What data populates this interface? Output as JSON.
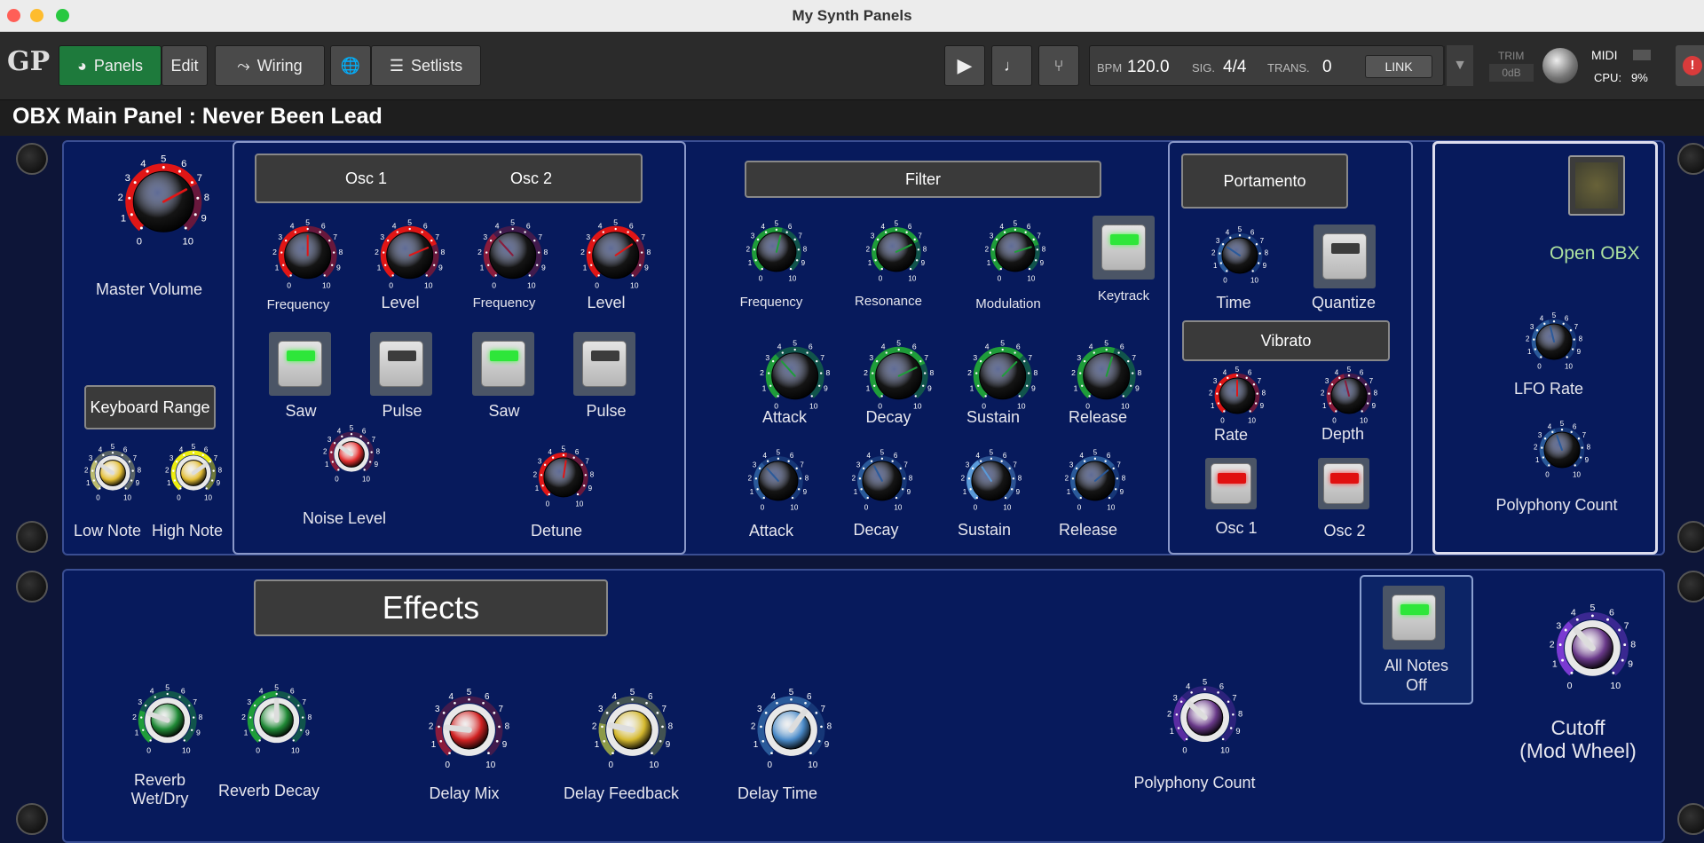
{
  "window": {
    "title": "My Synth Panels"
  },
  "toolbar": {
    "logo": "GP",
    "panels": "Panels",
    "edit": "Edit",
    "wiring": "Wiring",
    "setlists": "Setlists",
    "bpm_label": "BPM",
    "bpm": "120.0",
    "sig_label": "SIG.",
    "sig": "4/4",
    "trans_label": "TRANS.",
    "trans": "0",
    "link": "LINK",
    "trim_label": "TRIM",
    "trim": "0dB",
    "midi": "MIDI",
    "cpu_label": "CPU:",
    "cpu": "9%"
  },
  "panel_title": "OBX Main Panel : Never Been Lead",
  "buttons": {
    "osc12": {
      "osc1": "Osc 1",
      "osc2": "Osc 2"
    },
    "filter": "Filter",
    "portamento": "Portamento",
    "vibrato": "Vibrato",
    "keyboard_range": "Keyboard Range",
    "effects": "Effects"
  },
  "labels": {
    "master_volume": "Master Volume",
    "low_note": "Low Note",
    "high_note": "High Note",
    "osc1_frequency": "Frequency",
    "osc1_level": "Level",
    "osc2_frequency": "Frequency",
    "osc2_level": "Level",
    "saw1": "Saw",
    "pulse1": "Pulse",
    "saw2": "Saw",
    "pulse2": "Pulse",
    "noise_level": "Noise Level",
    "detune": "Detune",
    "filter_frequency": "Frequency",
    "resonance": "Resonance",
    "modulation": "Modulation",
    "keytrack": "Keytrack",
    "attack1": "Attack",
    "decay1": "Decay",
    "sustain1": "Sustain",
    "release1": "Release",
    "attack2": "Attack",
    "decay2": "Decay",
    "sustain2": "Sustain",
    "release2": "Release",
    "time": "Time",
    "quantize": "Quantize",
    "rate": "Rate",
    "depth": "Depth",
    "vib_osc1": "Osc 1",
    "vib_osc2": "Osc 2",
    "open_obx": "Open  OBX",
    "lfo_rate": "LFO Rate",
    "polyphony_count_top": "Polyphony Count",
    "reverb_wetdry_1": "Reverb",
    "reverb_wetdry_2": "Wet/Dry",
    "reverb_decay": "Reverb Decay",
    "delay_mix": "Delay Mix",
    "delay_feedback": "Delay Feedback",
    "delay_time": "Delay Time",
    "polyphony_count_bottom": "Polyphony Count",
    "all_notes_1": "All Notes",
    "all_notes_2": "Off",
    "cutoff_1": "Cutoff",
    "cutoff_2": "(Mod Wheel)"
  },
  "knob_scale": {
    "ticks": [
      "1",
      "2",
      "3",
      "4",
      "5",
      "6",
      "7",
      "8",
      "9"
    ],
    "min": "0",
    "max": "10"
  },
  "knobs": [
    {
      "id": "master-volume",
      "value": 7.2,
      "color": "#e01616",
      "cap": "#151515"
    },
    {
      "id": "low-note",
      "value": 3.0,
      "color": "#bcbc70",
      "cap": "#e4be35"
    },
    {
      "id": "high-note",
      "value": 7.0,
      "color": "#eeee10",
      "cap": "#e4be35"
    },
    {
      "id": "osc1-frequency",
      "value": 5.0,
      "color": "#e01616",
      "cap": "#151515"
    },
    {
      "id": "osc1-level",
      "value": 7.4,
      "color": "#e01616",
      "cap": "#151515"
    },
    {
      "id": "osc2-frequency",
      "value": 3.5,
      "color": "#8a1c3c",
      "cap": "#151515"
    },
    {
      "id": "osc2-level",
      "value": 7.0,
      "color": "#e01616",
      "cap": "#151515"
    },
    {
      "id": "noise-level",
      "value": 3.0,
      "color": "#8a1c3c",
      "cap": "#e53030"
    },
    {
      "id": "detune",
      "value": 5.3,
      "color": "#e01616",
      "cap": "#151515"
    },
    {
      "id": "filter-frequency",
      "value": 5.5,
      "color": "#1f9d3a",
      "cap": "#151515"
    },
    {
      "id": "resonance",
      "value": 7.3,
      "color": "#1f9d3a",
      "cap": "#151515"
    },
    {
      "id": "modulation",
      "value": 7.6,
      "color": "#1f9d3a",
      "cap": "#151515"
    },
    {
      "id": "attack-1",
      "value": 3.5,
      "color": "#1f9d3a",
      "cap": "#151515"
    },
    {
      "id": "decay-1",
      "value": 7.3,
      "color": "#1f9d3a",
      "cap": "#151515"
    },
    {
      "id": "sustain-1",
      "value": 6.6,
      "color": "#1f9d3a",
      "cap": "#151515"
    },
    {
      "id": "release-1",
      "value": 5.6,
      "color": "#1f9d3a",
      "cap": "#151515"
    },
    {
      "id": "attack-2",
      "value": 3.5,
      "color": "#2a5a9a",
      "cap": "#151515"
    },
    {
      "id": "decay-2",
      "value": 4.0,
      "color": "#2a5a9a",
      "cap": "#151515"
    },
    {
      "id": "sustain-2",
      "value": 3.8,
      "color": "#5a9ad8",
      "cap": "#151515"
    },
    {
      "id": "release-2",
      "value": 6.8,
      "color": "#2a5a9a",
      "cap": "#151515"
    },
    {
      "id": "portamento-time",
      "value": 3.0,
      "color": "#2a5a9a",
      "cap": "#151515"
    },
    {
      "id": "vibrato-rate",
      "value": 5.0,
      "color": "#e01616",
      "cap": "#151515"
    },
    {
      "id": "vibrato-depth",
      "value": 4.5,
      "color": "#8a1c3c",
      "cap": "#151515"
    },
    {
      "id": "lfo-rate",
      "value": 4.5,
      "color": "#2a5a9a",
      "cap": "#151515"
    },
    {
      "id": "polyphony-count-top",
      "value": 4.3,
      "color": "#2a5a9a",
      "cap": "#151515"
    },
    {
      "id": "reverb-wet-dry",
      "value": 2.5,
      "color": "#1f9d3a",
      "cap": "#208a36"
    },
    {
      "id": "reverb-decay",
      "value": 5.0,
      "color": "#1f9d3a",
      "cap": "#208a36"
    },
    {
      "id": "delay-mix",
      "value": 2.0,
      "color": "#8a1c3c",
      "cap": "#d12222"
    },
    {
      "id": "delay-feedback",
      "value": 2.2,
      "color": "#8d9a48",
      "cap": "#d4b82e"
    },
    {
      "id": "delay-time",
      "value": 6.3,
      "color": "#2a5a9a",
      "cap": "#4a8ac8"
    },
    {
      "id": "polyphony-count-bottom",
      "value": 3.3,
      "color": "#5a2ca2",
      "cap": "#6a3a8a"
    },
    {
      "id": "cutoff",
      "value": 3.5,
      "color": "#7a3ad2",
      "cap": "#6a3a8a"
    }
  ]
}
